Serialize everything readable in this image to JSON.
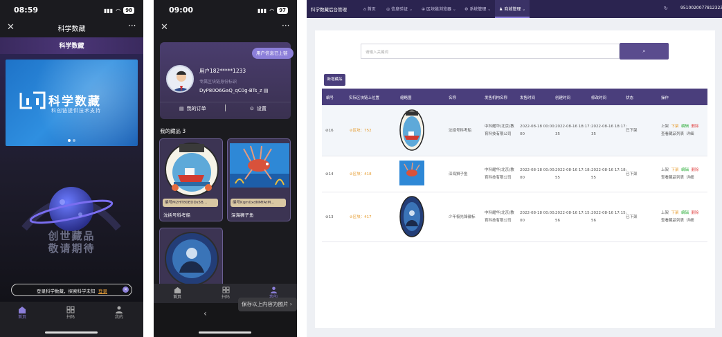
{
  "phone1": {
    "time": "08:59",
    "battery": "98",
    "title": "科学数藏",
    "subtitle": "科学数藏",
    "banner_logo_text": "科学数藏",
    "banner_tagline": "科创链提供技术支持",
    "coming_soon_line1": "创世藏品",
    "coming_soon_line2": "敬请期待",
    "login_prompt": "登录科学数藏，探索科学未知",
    "login_link": "登录",
    "nav": [
      {
        "label": "首页",
        "icon": "home-icon"
      },
      {
        "label": "扫码",
        "icon": "qr-icon"
      },
      {
        "label": "我的",
        "icon": "user-icon"
      }
    ]
  },
  "phone2": {
    "time": "09:00",
    "battery": "97",
    "onchain_badge": "用户信息已上链",
    "user_name": "用户182*****1233",
    "identity_label": "专属区块链身份标识",
    "chain_id": "DyP80O6GaQ_qC0g-BTs_z",
    "my_orders": "我的订单",
    "settings": "设置",
    "collection_title": "我的藏品",
    "collection_count": "3",
    "items": [
      {
        "code": "编号M2HT80EDDs5B...",
        "name": "沈括号科考船"
      },
      {
        "code": "编号Kqm0xdNMfAtM...",
        "name": "深海狮子鱼"
      }
    ],
    "nav": [
      {
        "label": "首页",
        "icon": "home-icon"
      },
      {
        "label": "扫码",
        "icon": "qr-icon"
      },
      {
        "label": "我的",
        "icon": "user-icon"
      }
    ],
    "save_tooltip": "保存以上内容为图片 ›"
  },
  "admin": {
    "brand": "科学数藏后台管理",
    "menu": [
      {
        "label": "首页",
        "icon": "home-icon",
        "arrow": ""
      },
      {
        "label": "信息验证",
        "icon": "shield-icon",
        "arrow": "⌄"
      },
      {
        "label": "区块链浏览器",
        "icon": "link-icon",
        "arrow": "⌄"
      },
      {
        "label": "系统管理",
        "icon": "gear-icon",
        "arrow": "⌄"
      },
      {
        "label": "商城管理",
        "icon": "user-icon",
        "arrow": "⌄"
      }
    ],
    "account": "95100200778123233",
    "search_placeholder": "请输入关键词",
    "add_button": "新增藏品",
    "columns": [
      "编号",
      "实际区块链上位置",
      "缩略图",
      "名称",
      "发售机构名称",
      "发售时间",
      "创建时间",
      "修改时间",
      "状态",
      "操作"
    ],
    "rows": [
      {
        "id": "16",
        "chain": "区块：752",
        "name": "沈括号科考船",
        "org": [
          "中科耀华(北京)教",
          "育科技有限公司"
        ],
        "sale": [
          "2022-08-18 00:00:",
          "00"
        ],
        "created": [
          "2022-08-16 18:17:",
          "35"
        ],
        "modified": [
          "2022-08-16 18:17:",
          "35"
        ],
        "status": "已下架"
      },
      {
        "id": "14",
        "chain": "区块：418",
        "name": "深海狮子鱼",
        "org": [
          "中科耀华(北京)教",
          "育科技有限公司"
        ],
        "sale": [
          "2022-08-18 00:00:",
          "00"
        ],
        "created": [
          "2022-08-16 17:18:",
          "55"
        ],
        "modified": [
          "2022-08-16 17:18:",
          "55"
        ],
        "status": "已下架"
      },
      {
        "id": "13",
        "chain": "区块：417",
        "name": "少年极先锋徽标",
        "org": [
          "中科耀华(北京)教",
          "育科技有限公司"
        ],
        "sale": [
          "2022-08-18 00:00:",
          "00"
        ],
        "created": [
          "2022-08-16 17:15:",
          "56"
        ],
        "modified": [
          "2022-08-16 17:15:",
          "56"
        ],
        "status": "已下架"
      }
    ],
    "ops": {
      "on": "上架",
      "off": "下架",
      "edit": "编辑",
      "delete": "删除",
      "view": "查看藏品列表",
      "detail": "详细"
    }
  }
}
